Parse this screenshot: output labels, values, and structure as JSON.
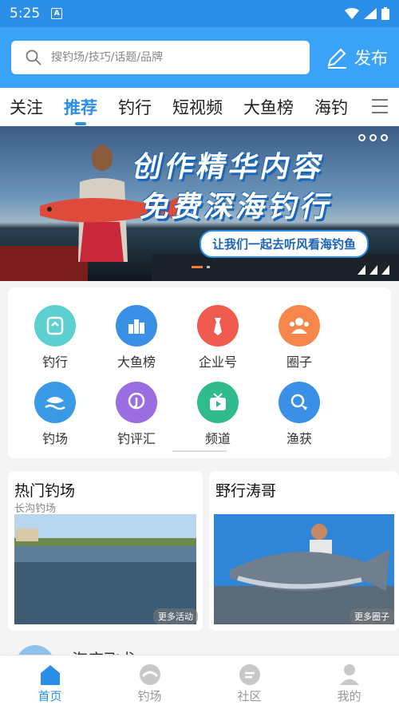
{
  "status_bar": {
    "time": "5:25",
    "notification": "A"
  },
  "header": {
    "search_placeholder": "搜钓场/技巧/话题/品牌",
    "publish_label": "发布"
  },
  "tabs": [
    {
      "label": "关注",
      "active": false
    },
    {
      "label": "推荐",
      "active": true
    },
    {
      "label": "钓行",
      "active": false
    },
    {
      "label": "短视频",
      "active": false
    },
    {
      "label": "大鱼榜",
      "active": false
    },
    {
      "label": "海钓",
      "active": false
    }
  ],
  "banner": {
    "headline_1": "创作精华内容",
    "headline_2": "免费深海钓行",
    "slogan": "让我们一起去听风看海钓鱼"
  },
  "grid": [
    {
      "label": "钓行",
      "icon": "fishing-trip-icon",
      "color": "#5ccfd0"
    },
    {
      "label": "大鱼榜",
      "icon": "ranking-icon",
      "color": "#3a8fe6"
    },
    {
      "label": "企业号",
      "icon": "business-tie-icon",
      "color": "#f05a4f"
    },
    {
      "label": "圈子",
      "icon": "group-icon",
      "color": "#f7864c"
    },
    {
      "label": "钓场",
      "icon": "fish-wave-icon",
      "color": "#3a9ae8"
    },
    {
      "label": "钓评汇",
      "icon": "hook-review-icon",
      "color": "#9b6de0"
    },
    {
      "label": "频道",
      "icon": "tv-channel-icon",
      "color": "#2fbb8c"
    },
    {
      "label": "渔获",
      "icon": "catch-icon",
      "color": "#3a8fe6"
    }
  ],
  "cards": [
    {
      "title": "热门钓场",
      "subtitle": "长沟钓场",
      "more": "更多活动"
    },
    {
      "title": "野行涛哥",
      "more": "更多圈子"
    }
  ],
  "peek_text": "海店飞尤",
  "bottom_nav": [
    {
      "label": "首页",
      "icon": "home-icon",
      "active": true
    },
    {
      "label": "钓场",
      "icon": "fishing-spot-icon",
      "active": false
    },
    {
      "label": "社区",
      "icon": "community-icon",
      "active": false
    },
    {
      "label": "我的",
      "icon": "profile-icon",
      "active": false
    }
  ],
  "colors": {
    "brand": "#3aa3f7",
    "active": "#2b8fe8"
  }
}
